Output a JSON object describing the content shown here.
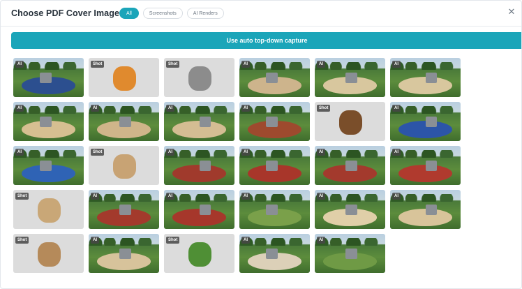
{
  "header": {
    "title": "Choose PDF Cover Image",
    "close_icon": "close-icon"
  },
  "filters": [
    {
      "label": "All",
      "active": true
    },
    {
      "label": "Screenshots",
      "active": false
    },
    {
      "label": "AI Renders",
      "active": false
    }
  ],
  "capture_button": {
    "label": "Use auto top-down capture"
  },
  "colors": {
    "accent": "#1ba5b9",
    "badge": "#464646",
    "shot_bg": "#dcdcdc"
  },
  "tiles": [
    {
      "badge": "AI",
      "kind": "render",
      "ground": "#2c4f8f"
    },
    {
      "badge": "Shot",
      "kind": "shot",
      "ground": "#e08a2e"
    },
    {
      "badge": "Shot",
      "kind": "shot",
      "ground": "#8c8c8c"
    },
    {
      "badge": "AI",
      "kind": "render",
      "ground": "#cdb48c"
    },
    {
      "badge": "AI",
      "kind": "render",
      "ground": "#d8c79e"
    },
    {
      "badge": "AI",
      "kind": "render",
      "ground": "#d8c79e"
    },
    {
      "badge": "AI",
      "kind": "render",
      "ground": "#d6bf91"
    },
    {
      "badge": "AI",
      "kind": "render",
      "ground": "#cfb58a"
    },
    {
      "badge": "AI",
      "kind": "render",
      "ground": "#d4bd93"
    },
    {
      "badge": "AI",
      "kind": "render",
      "ground": "#9e4a2e"
    },
    {
      "badge": "Shot",
      "kind": "shot",
      "ground": "#7a4e2a"
    },
    {
      "badge": "AI",
      "kind": "render",
      "ground": "#2c55a8"
    },
    {
      "badge": "AI",
      "kind": "render",
      "ground": "#2f63b5"
    },
    {
      "badge": "Shot",
      "kind": "shot",
      "ground": "#c8a374"
    },
    {
      "badge": "AI",
      "kind": "render",
      "ground": "#a03a2c"
    },
    {
      "badge": "AI",
      "kind": "render",
      "ground": "#a8362a"
    },
    {
      "badge": "AI",
      "kind": "render",
      "ground": "#a33a2d"
    },
    {
      "badge": "AI",
      "kind": "render",
      "ground": "#b03a2e"
    },
    {
      "badge": "Shot",
      "kind": "shot",
      "ground": "#c9a777"
    },
    {
      "badge": "AI",
      "kind": "render",
      "ground": "#a33a2c"
    },
    {
      "badge": "AI",
      "kind": "render",
      "ground": "#a6372b"
    },
    {
      "badge": "AI",
      "kind": "render",
      "ground": "#7aa04a"
    },
    {
      "badge": "AI",
      "kind": "render",
      "ground": "#e0cfa8"
    },
    {
      "badge": "AI",
      "kind": "render",
      "ground": "#d8c49a"
    },
    {
      "badge": "Shot",
      "kind": "shot",
      "ground": "#b58a5a"
    },
    {
      "badge": "AI",
      "kind": "render",
      "ground": "#d7c39b"
    },
    {
      "badge": "Shot",
      "kind": "shot",
      "ground": "#4f8f35"
    },
    {
      "badge": "AI",
      "kind": "render",
      "ground": "#dcd0b8"
    },
    {
      "badge": "AI",
      "kind": "render",
      "ground": "#6f9a45"
    }
  ]
}
